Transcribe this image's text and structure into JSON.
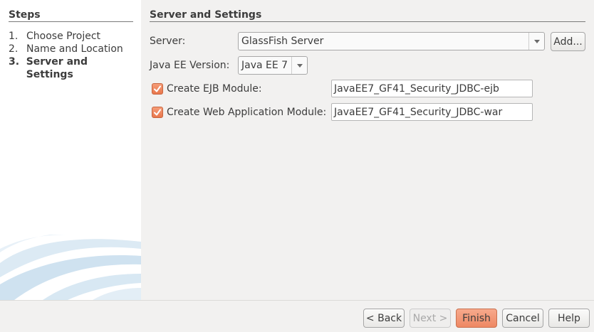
{
  "steps": {
    "title": "Steps",
    "items": [
      {
        "number": "1.",
        "label": "Choose Project",
        "current": false
      },
      {
        "number": "2.",
        "label": "Name and Location",
        "current": false
      },
      {
        "number": "3.",
        "label": "Server and Settings",
        "current": true
      }
    ]
  },
  "main": {
    "title": "Server and Settings",
    "server": {
      "label": "Server:",
      "value": "GlassFish Server",
      "add_label": "Add..."
    },
    "java_ee": {
      "label": "Java EE Version:",
      "value": "Java EE 7"
    },
    "ejb": {
      "label": "Create EJB Module:",
      "checked": true,
      "value": "JavaEE7_GF41_Security_JDBC-ejb"
    },
    "web": {
      "label": "Create Web Application Module:",
      "checked": true,
      "value": "JavaEE7_GF41_Security_JDBC-war"
    }
  },
  "footer": {
    "back_label": "< Back",
    "next_label": "Next >",
    "finish_label": "Finish",
    "cancel_label": "Cancel",
    "help_label": "Help"
  },
  "colors": {
    "accent": "#ee8863",
    "panel_bg": "#f2f1f0"
  }
}
